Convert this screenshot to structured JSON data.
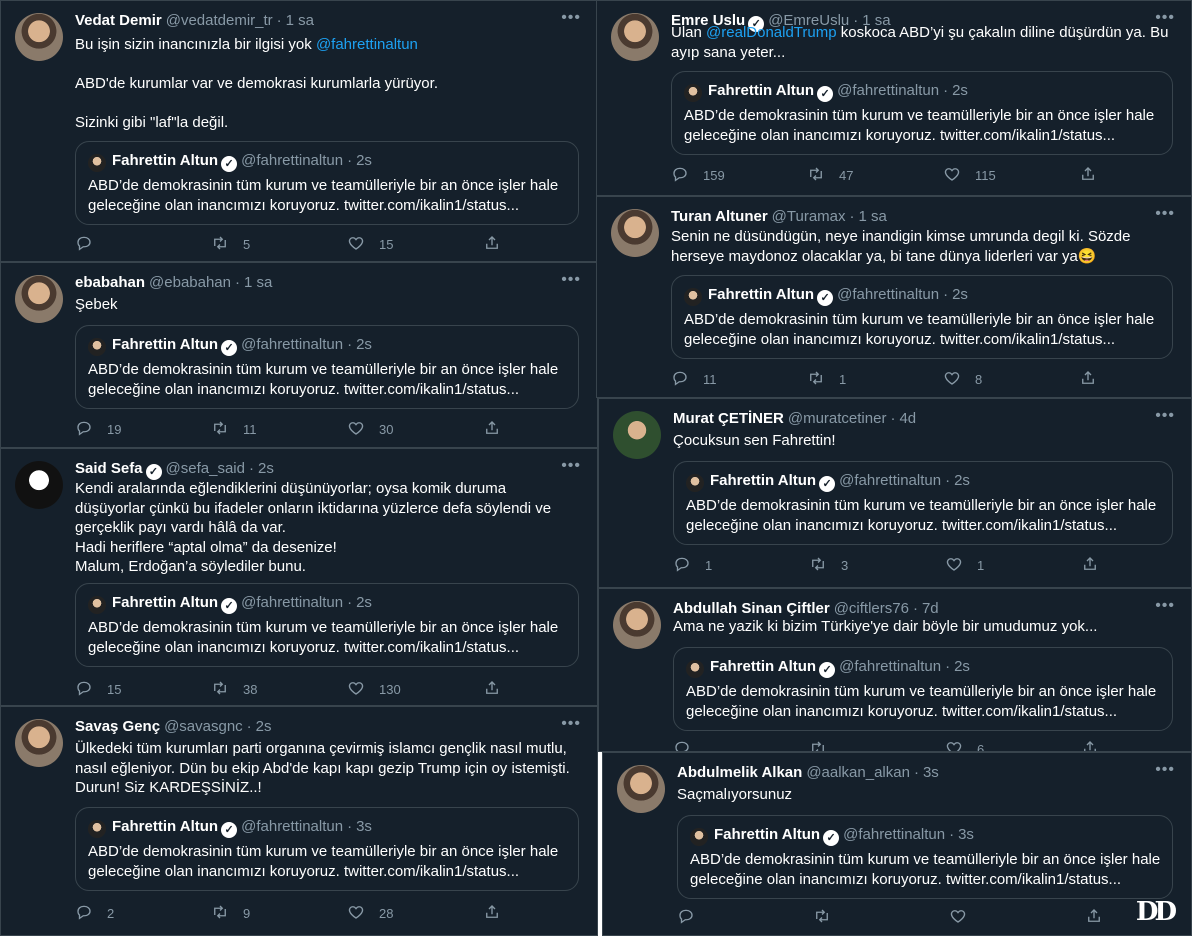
{
  "quoted": {
    "name": "Fahrettin Altun",
    "handle": "@fahrettinaltun",
    "text": "ABD’de demokrasinin tüm kurum ve teamülleriyle bir an önce işler hale geleceğine olan inancımızı koruyoruz. twitter.com/ikalin1/status..."
  },
  "tweets": [
    {
      "name": "Vedat Demir",
      "handle": "@vedatdemir_tr",
      "time": "1 sa",
      "verified": false,
      "text_pre": "Bu işin sizin inancınızla bir ilgisi yok ",
      "text_link": "@fahrettinaltun",
      "text_post": "\n\nABD'de kurumlar var ve demokrasi kurumlarla yürüyor.\n\nSizinki gibi \"laf\"la değil.",
      "quote_time": "2s",
      "replies": "",
      "retweets": "5",
      "likes": "15"
    },
    {
      "name": "ebabahan",
      "handle": "@ebabahan",
      "time": "1 sa",
      "verified": false,
      "text_pre": "Şebek",
      "text_link": "",
      "text_post": "",
      "quote_time": "2s",
      "replies": "19",
      "retweets": "11",
      "likes": "30"
    },
    {
      "name": "Said Sefa",
      "handle": "@sefa_said",
      "time": "2s",
      "verified": true,
      "text_pre": "Kendi aralarında eğlendiklerini düşünüyorlar; oysa komik duruma düşüyorlar çünkü bu ifadeler onların iktidarına yüzlerce defa söylendi ve gerçeklik payı vardı hâlâ da var.\nHadi heriflere “aptal olma” da desenize!\nMalum, Erdoğan’a söylediler bunu.",
      "text_link": "",
      "text_post": "",
      "quote_time": "2s",
      "replies": "15",
      "retweets": "38",
      "likes": "130"
    },
    {
      "name": "Savaş Genç",
      "handle": "@savasgnc",
      "time": "2s",
      "verified": false,
      "text_pre": "Ülkedeki tüm kurumları parti organına çevirmiş islamcı gençlik nasıl mutlu, nasıl eğleniyor. Dün bu ekip Abd'de kapı kapı gezip Trump için oy istemişti. Durun! Siz KARDEŞSİNİZ..!",
      "text_link": "",
      "text_post": "",
      "quote_time": "3s",
      "replies": "2",
      "retweets": "9",
      "likes": "28"
    },
    {
      "name": "Emre Uslu",
      "handle": "@EmreUslu",
      "time": "1 sa",
      "verified": true,
      "text_pre": "Ulan ",
      "text_link": "@realDonaldTrump",
      "text_post": " koskoca ABD’yi şu çakalın diline düşürdün ya. Bu ayıp sana yeter...",
      "quote_time": "2s",
      "replies": "159",
      "retweets": "47",
      "likes": "115"
    },
    {
      "name": "Turan Altuner",
      "handle": "@Turamax",
      "time": "1 sa",
      "verified": false,
      "text_pre": "Senin ne düsündügün, neye inandigin kimse umrunda degil ki. Sözde herseye maydonoz olacaklar ya, bi tane dünya liderleri var ya😆",
      "text_link": "",
      "text_post": "",
      "quote_time": "2s",
      "replies": "11",
      "retweets": "1",
      "likes": "8"
    },
    {
      "name": "Murat ÇETİNER",
      "handle": "@muratcetiner",
      "time": "4d",
      "verified": false,
      "text_pre": "Çocuksun sen Fahrettin!",
      "text_link": "",
      "text_post": "",
      "quote_time": "2s",
      "replies": "1",
      "retweets": "3",
      "likes": "1"
    },
    {
      "name": "Abdullah Sinan Çiftler",
      "handle": "@ciftlers76",
      "time": "7d",
      "verified": false,
      "text_pre": "Ama ne yazik ki bizim Türkiye'ye dair böyle bir umudumuz yok...",
      "text_link": "",
      "text_post": "",
      "quote_time": "2s",
      "replies": "",
      "retweets": "",
      "likes": "6"
    },
    {
      "name": "Abdulmelik Alkan",
      "handle": "@aalkan_alkan",
      "time": "3s",
      "verified": false,
      "text_pre": "Saçmalıyorsunuz",
      "text_link": "",
      "text_post": "",
      "quote_time": "3s",
      "replies": "",
      "retweets": "",
      "likes": ""
    }
  ],
  "watermark": "DD",
  "colors": {
    "bg": "#15202b",
    "border": "#38444d",
    "muted": "#8899a6",
    "link": "#1da1f2"
  }
}
